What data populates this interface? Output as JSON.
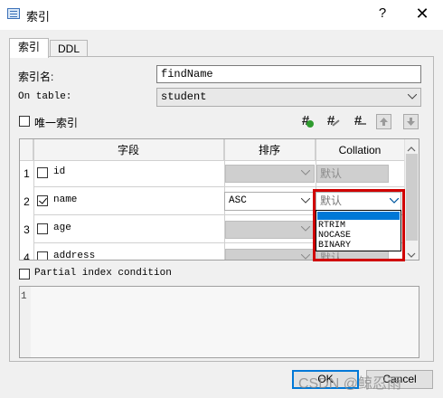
{
  "window": {
    "title": "索引",
    "help_label": "?",
    "close_label": "✕",
    "icon": "table-window-icon"
  },
  "tabs": [
    {
      "label": "索引",
      "active": true
    },
    {
      "label": "DDL",
      "active": false
    }
  ],
  "form": {
    "index_name_label": "索引名:",
    "index_name_value": "findName",
    "on_table_label": "On table:",
    "on_table_value": "student",
    "unique_label": "唯一索引",
    "unique_checked": false
  },
  "toolbar": {
    "icons": [
      "add-column-icon",
      "edit-column-icon",
      "remove-column-icon",
      "move-up-icon",
      "move-down-icon"
    ],
    "hash_glyph": "#"
  },
  "grid": {
    "headers": {
      "field": "字段",
      "sort": "排序",
      "collation": "Collation"
    },
    "rows": [
      {
        "num": "1",
        "name": "id",
        "checked": false,
        "sort": "",
        "collation": "默认"
      },
      {
        "num": "2",
        "name": "name",
        "checked": true,
        "sort": "ASC",
        "collation": "默认"
      },
      {
        "num": "3",
        "name": "age",
        "checked": false,
        "sort": "",
        "collation": ""
      },
      {
        "num": "4",
        "name": "address",
        "checked": false,
        "sort": "",
        "collation": "默认"
      }
    ],
    "collation_options": [
      "",
      "RTRIM",
      "NOCASE",
      "BINARY"
    ],
    "highlight_color": "#0078d7",
    "callout_color": "#d00000"
  },
  "partial": {
    "label": "Partial index condition",
    "checked": false,
    "line_number": "1"
  },
  "buttons": {
    "ok": "OK",
    "cancel": "Cancel"
  },
  "watermark": "CSDN @鲸忍雨"
}
